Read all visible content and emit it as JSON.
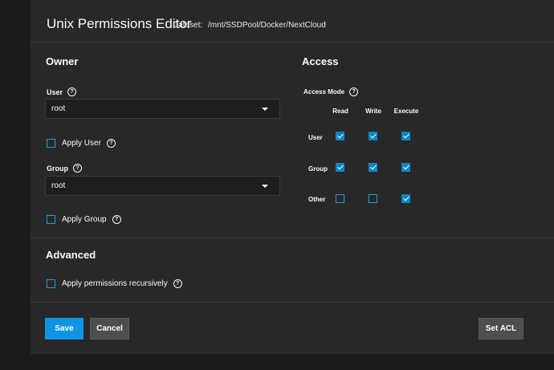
{
  "dialog": {
    "title": "Unix Permissions Editor",
    "dataset_label": "Dataset:",
    "dataset_path": "/mnt/SSDPool/Docker/NextCloud"
  },
  "owner": {
    "title": "Owner",
    "user_label": "User",
    "user_value": "root",
    "apply_user_label": "Apply User",
    "apply_user_checked": false,
    "group_label": "Group",
    "group_value": "root",
    "apply_group_label": "Apply Group",
    "apply_group_checked": false
  },
  "access": {
    "title": "Access",
    "mode_label": "Access Mode",
    "columns": [
      "Read",
      "Write",
      "Execute"
    ],
    "rows": [
      {
        "label": "User",
        "read": true,
        "write": true,
        "execute": true
      },
      {
        "label": "Group",
        "read": true,
        "write": true,
        "execute": true
      },
      {
        "label": "Other",
        "read": false,
        "write": false,
        "execute": true
      }
    ]
  },
  "advanced": {
    "title": "Advanced",
    "recursive_label": "Apply permissions recursively",
    "recursive_checked": false
  },
  "buttons": {
    "save": "Save",
    "cancel": "Cancel",
    "set_acl": "Set ACL"
  },
  "colors": {
    "accent": "#0d95e3",
    "panel_bg": "#282828",
    "page_bg": "#1b1b1b"
  },
  "icons": {
    "help": "help-circle-icon",
    "caret": "chevron-down-icon",
    "check": "check-icon"
  }
}
